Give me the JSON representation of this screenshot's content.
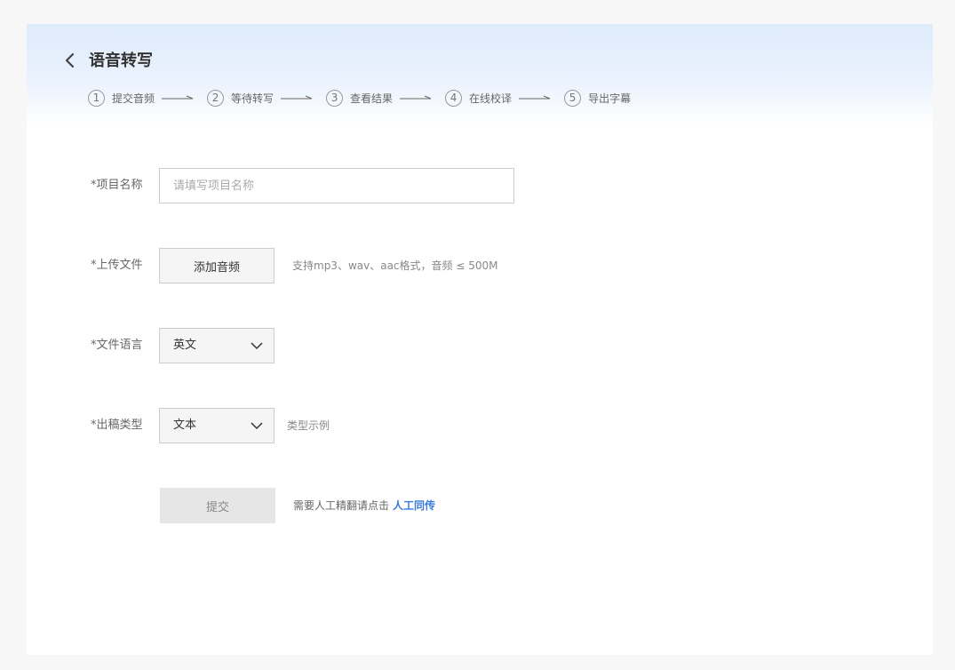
{
  "header": {
    "title": "语音转写",
    "steps": [
      {
        "num": "1",
        "label": "提交音频"
      },
      {
        "num": "2",
        "label": "等待转写"
      },
      {
        "num": "3",
        "label": "查看结果"
      },
      {
        "num": "4",
        "label": "在线校译"
      },
      {
        "num": "5",
        "label": "导出字幕"
      }
    ]
  },
  "form": {
    "project_name": {
      "label": "*项目名称",
      "value": "",
      "placeholder": "请填写项目名称"
    },
    "upload": {
      "label": "*上传文件",
      "button": "添加音频",
      "hint": "支持mp3、wav、aac格式，音频 ≤ 500M"
    },
    "language": {
      "label": "*文件语言",
      "value": "英文"
    },
    "output_type": {
      "label": "*出稿类型",
      "value": "文本",
      "hint": "类型示例"
    },
    "submit": {
      "button": "提交",
      "hint": "需要人工精翻请点击",
      "link": "人工同传"
    }
  },
  "colors": {
    "accent": "#3a7bdc",
    "header_gradient_top": "#deebfb"
  },
  "icons": {
    "back": "chevron-left-icon",
    "select": "chevron-down-icon",
    "step_arrow": "arrow-right-icon"
  }
}
